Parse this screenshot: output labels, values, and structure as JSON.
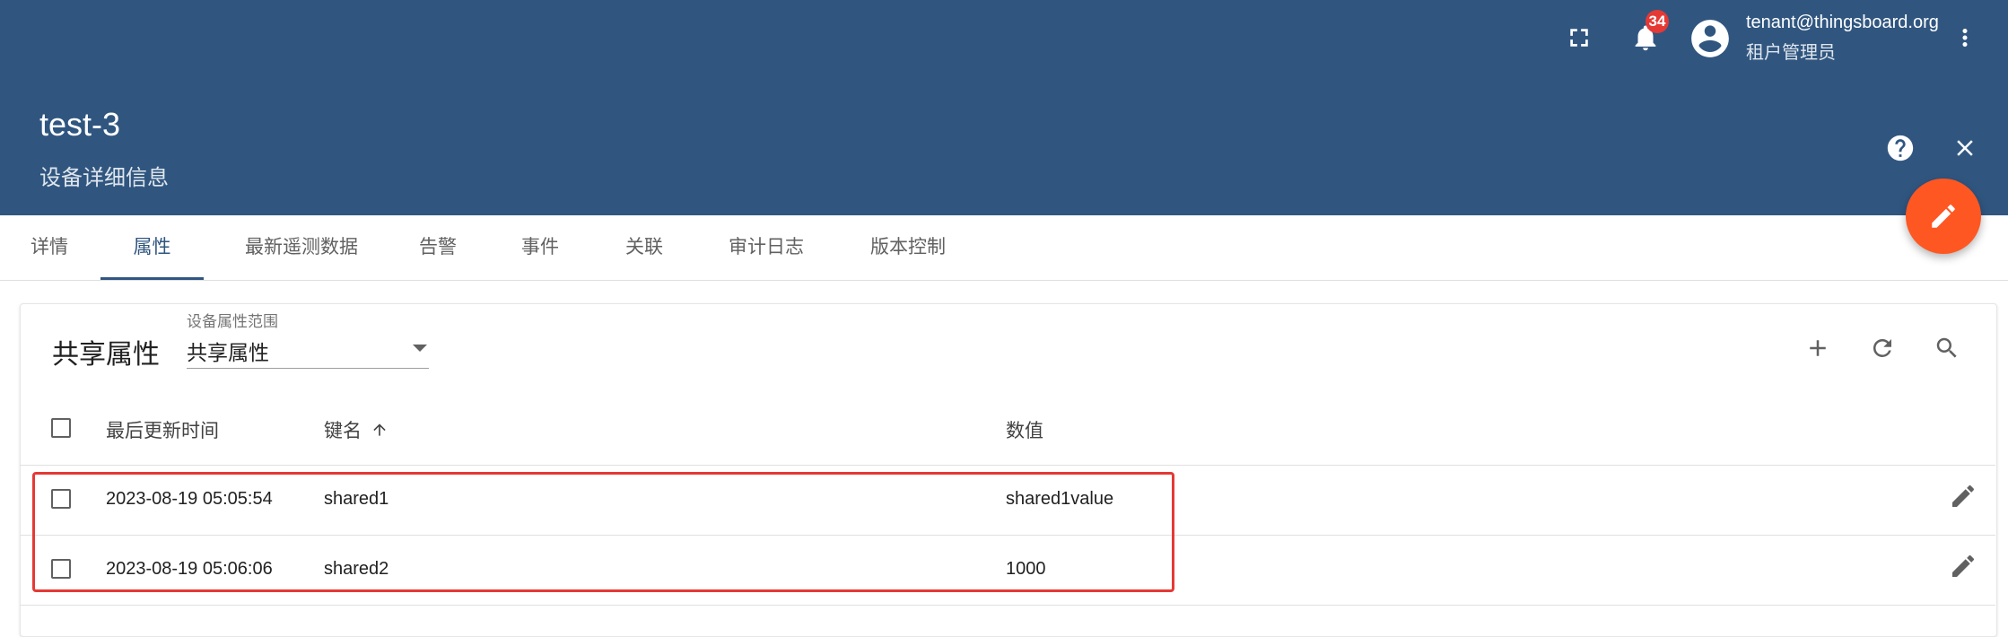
{
  "topbar": {
    "notification_count": "34",
    "user_email": "tenant@thingsboard.org",
    "user_role": "租户管理员",
    "icons": [
      "fullscreen-icon",
      "bell-icon",
      "account-circle-icon",
      "more-vert-icon"
    ]
  },
  "entity": {
    "title": "test-3",
    "subtitle": "设备详细信息",
    "icons": [
      "help-icon",
      "close-icon",
      "edit-icon"
    ]
  },
  "tabs": [
    {
      "label": "详情"
    },
    {
      "label": "属性"
    },
    {
      "label": "最新遥测数据"
    },
    {
      "label": "告警"
    },
    {
      "label": "事件"
    },
    {
      "label": "关联"
    },
    {
      "label": "审计日志"
    },
    {
      "label": "版本控制"
    }
  ],
  "active_tab": "属性",
  "attributes": {
    "title": "共享属性",
    "scope_label": "设备属性范围",
    "scope_value": "共享属性",
    "toolbar_icons": [
      "add-icon",
      "refresh-icon",
      "search-icon"
    ],
    "columns": {
      "last_update": "最后更新时间",
      "key": "键名",
      "value": "数值"
    },
    "sort_indicator": "arrow-upward-icon",
    "rows": [
      {
        "time": "2023-08-19 05:05:54",
        "key": "shared1",
        "value": "shared1value"
      },
      {
        "time": "2023-08-19 05:06:06",
        "key": "shared2",
        "value": "1000"
      }
    ]
  },
  "colors": {
    "header_bg": "#305680",
    "accent": "#305680",
    "fab": "#ff5722",
    "badge": "#e53935",
    "highlight_border": "#e53935"
  }
}
